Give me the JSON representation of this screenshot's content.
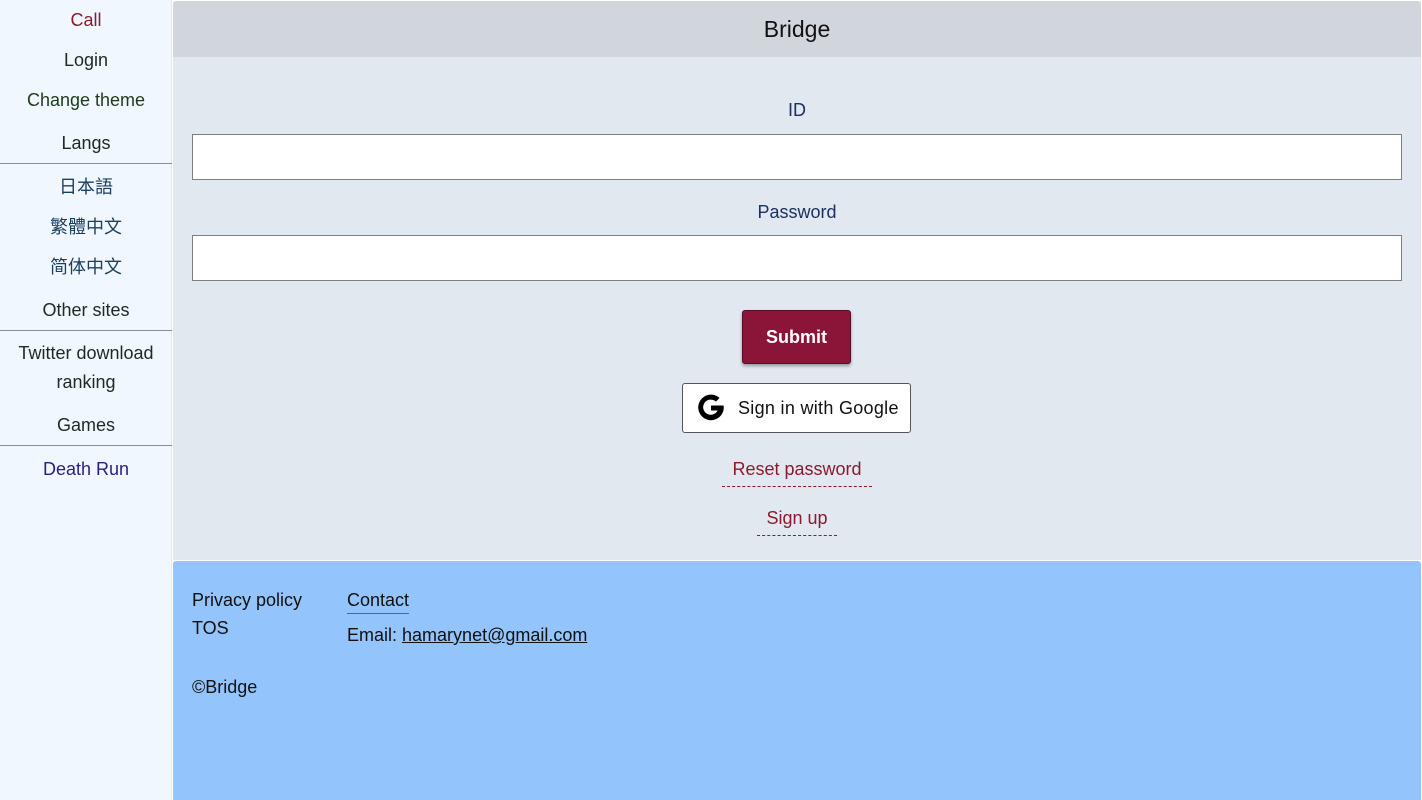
{
  "sidebar": {
    "call": "Call",
    "login": "Login",
    "change_theme": "Change theme",
    "langs_header": "Langs",
    "langs": [
      "日本語",
      "繁體中文",
      "简体中文"
    ],
    "other_sites_header": "Other sites",
    "twitter_line1": "Twitter download",
    "twitter_line2": "ranking",
    "games_header": "Games",
    "death_run": "Death Run"
  },
  "header": {
    "title": "Bridge"
  },
  "form": {
    "id_label": "ID",
    "id_value": "",
    "password_label": "Password",
    "password_value": "",
    "submit_label": "Submit",
    "google_label": "Sign in with Google",
    "reset_password": "Reset password",
    "sign_up": "Sign up"
  },
  "footer": {
    "privacy": "Privacy policy",
    "tos": "TOS",
    "contact_heading": "Contact",
    "email_label": "Email:",
    "email": "hamarynet@gmail.com",
    "copyright": "©Bridge"
  },
  "colors": {
    "sidebar_bg": "#f0f7ff",
    "header_bg": "#d1d5dc",
    "form_bg": "#e1e8f0",
    "accent": "#8b1538",
    "footer_bg": "#93c4fb"
  }
}
